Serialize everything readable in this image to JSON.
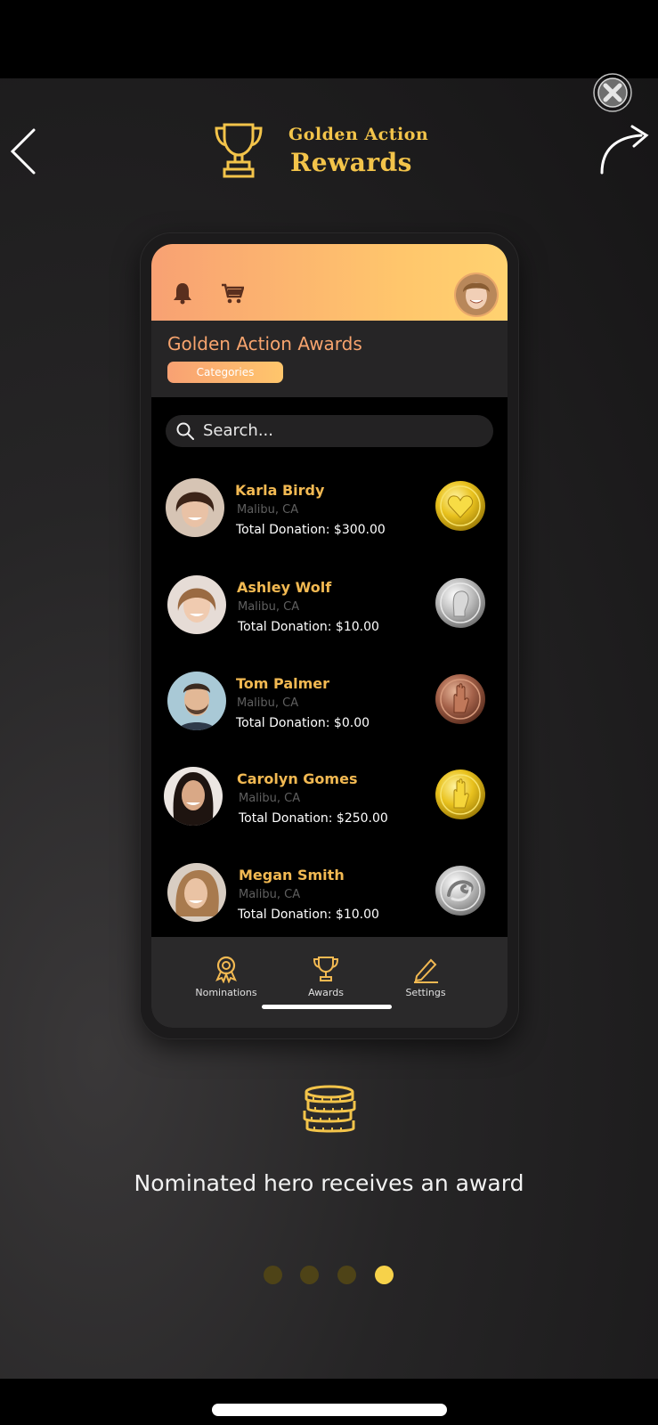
{
  "brand": {
    "line1": "Golden Action",
    "line2": "Rewards"
  },
  "phone": {
    "title": "Golden Action Awards",
    "categories_label": "Categories",
    "search_placeholder": "Search...",
    "people": [
      {
        "name": "Karla Birdy",
        "location": "Malibu, CA",
        "donation": "Total Donation: $300.00",
        "medal": "gold-heart"
      },
      {
        "name": "Ashley Wolf",
        "location": "Malibu, CA",
        "donation": "Total Donation: $10.00",
        "medal": "silver-head"
      },
      {
        "name": "Tom Palmer",
        "location": "Malibu, CA",
        "donation": "Total Donation: $0.00",
        "medal": "bronze-hand"
      },
      {
        "name": "Carolyn  Gomes",
        "location": "Malibu, CA",
        "donation": "Total Donation: $250.00",
        "medal": "gold-hand"
      },
      {
        "name": "Megan Smith",
        "location": "Malibu, CA",
        "donation": "Total Donation: $10.00",
        "medal": "silver-swirl"
      }
    ],
    "tabs": [
      {
        "label": "Nominations",
        "icon": "ribbon-icon"
      },
      {
        "label": "Awards",
        "icon": "trophy-icon"
      },
      {
        "label": "Settings",
        "icon": "pencil-icon"
      }
    ]
  },
  "caption": "Nominated hero receives an award",
  "pagination": {
    "count": 4,
    "active_index": 3
  },
  "colors": {
    "accent_gold": "#f3c44a",
    "header_start": "#f8a173",
    "header_end": "#ffd270"
  }
}
